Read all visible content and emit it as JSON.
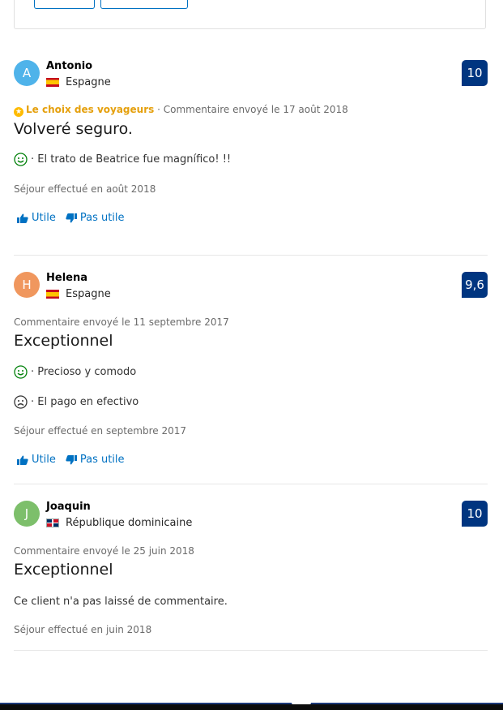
{
  "reviews": [
    {
      "initial": "A",
      "avatar_color": "#4fb3ea",
      "name": "Antonio",
      "country": "Espagne",
      "score": "10",
      "badge": "Le choix des voyageurs",
      "meta_separator": " · ",
      "meta": "Commentaire envoyé le 17 août 2018",
      "title": "Volveré seguro.",
      "positive": "· El trato de Beatrice fue magnífico! !!",
      "stay": "Séjour effectué en août 2018",
      "helpful_label": "Utile",
      "not_helpful_label": "Pas utile"
    },
    {
      "initial": "H",
      "avatar_color": "#f0975e",
      "name": "Helena",
      "country": "Espagne",
      "score": "9,6",
      "meta": "Commentaire envoyé le 11 septembre 2017",
      "title": "Exceptionnel",
      "positive": "· Precioso y comodo",
      "negative": "· El pago en efectivo",
      "stay": "Séjour effectué en septembre 2017",
      "helpful_label": "Utile",
      "not_helpful_label": "Pas utile"
    },
    {
      "initial": "J",
      "avatar_color": "#7dbf6b",
      "name": "Joaquin",
      "country": "République dominicaine",
      "score": "10",
      "meta": "Commentaire envoyé le 25 juin 2018",
      "title": "Exceptionnel",
      "no_comment": "Ce client n'a pas laissé de commentaire.",
      "stay": "Séjour effectué en juin 2018"
    }
  ],
  "colors": {
    "link": "#0071c2",
    "score_bg": "#003580",
    "positive": "#008009",
    "badge": "#e5a00d"
  },
  "icons": {
    "positive": "smile-icon",
    "negative": "frown-icon",
    "helpful": "thumbs-up-icon",
    "not_helpful": "thumbs-down-icon",
    "badge": "star-icon"
  }
}
